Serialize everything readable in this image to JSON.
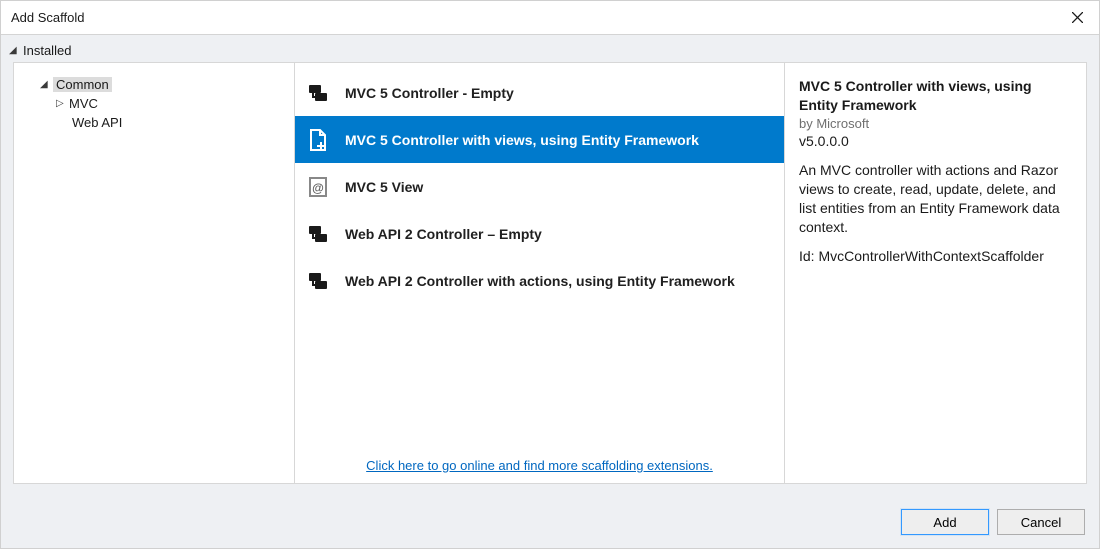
{
  "window": {
    "title": "Add Scaffold",
    "category": "Installed"
  },
  "tree": {
    "items": [
      {
        "label": "Common",
        "expanded": true,
        "selected": true,
        "depth": 0
      },
      {
        "label": "MVC",
        "expanded": false,
        "selected": false,
        "depth": 1,
        "hasChildren": true
      },
      {
        "label": "Web API",
        "expanded": false,
        "selected": false,
        "depth": 1,
        "hasChildren": false
      }
    ]
  },
  "list": {
    "items": [
      {
        "name": "MVC 5 Controller - Empty",
        "icon": "controller",
        "selected": false
      },
      {
        "name": "MVC 5 Controller with views, using Entity Framework",
        "icon": "page-plus",
        "selected": true
      },
      {
        "name": "MVC 5 View",
        "icon": "view-at",
        "selected": false
      },
      {
        "name": "Web API 2 Controller – Empty",
        "icon": "controller",
        "selected": false
      },
      {
        "name": "Web API 2 Controller with actions, using Entity Framework",
        "icon": "controller",
        "selected": false
      }
    ],
    "extensions_link": "Click here to go online and find more scaffolding extensions."
  },
  "details": {
    "title": "MVC 5 Controller with views, using Entity Framework",
    "by": "by Microsoft",
    "version": "v5.0.0.0",
    "description": "An MVC controller with actions and Razor views to create, read, update, delete, and list entities from an Entity Framework data context.",
    "id_label": "Id:",
    "id_value": "MvcControllerWithContextScaffolder"
  },
  "footer": {
    "add": "Add",
    "cancel": "Cancel"
  }
}
